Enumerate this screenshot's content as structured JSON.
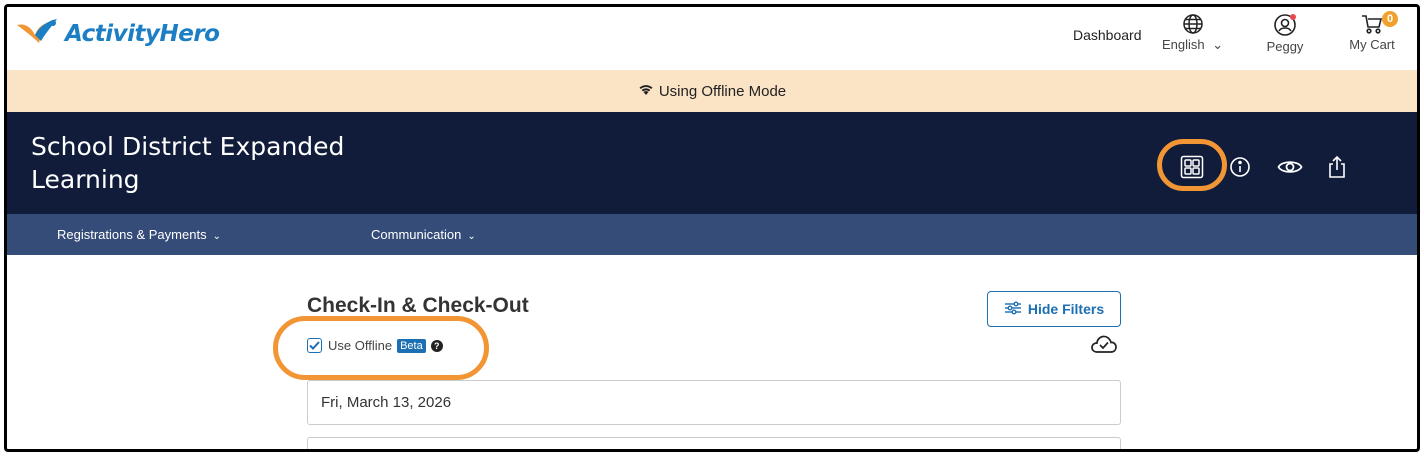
{
  "header": {
    "logo_text": "ActivityHero",
    "dashboard_label": "Dashboard",
    "language_label": "English",
    "user_label": "Peggy",
    "cart_label": "My Cart",
    "cart_count": "0"
  },
  "banner": {
    "text": "Using Offline Mode",
    "icon": "wifi-icon"
  },
  "titlebar": {
    "org_title": "School District Expanded Learning",
    "icons": [
      "grid-view-icon",
      "info-icon",
      "eye-icon",
      "share-icon"
    ]
  },
  "menu": {
    "items": [
      {
        "label": "Registrations & Payments"
      },
      {
        "label": "Communication"
      }
    ]
  },
  "content": {
    "heading": "Check-In & Check-Out",
    "hide_filters_label": "Hide Filters",
    "use_offline_label": "Use Offline",
    "use_offline_checked": true,
    "beta_label": "Beta",
    "date_value": "Fri, March 13, 2026"
  },
  "colors": {
    "brand_blue": "#1c7fc4",
    "accent_orange": "#f29534",
    "banner_bg": "#fbe3c5",
    "title_bg": "#101c3a",
    "menu_bg": "#354b78"
  }
}
